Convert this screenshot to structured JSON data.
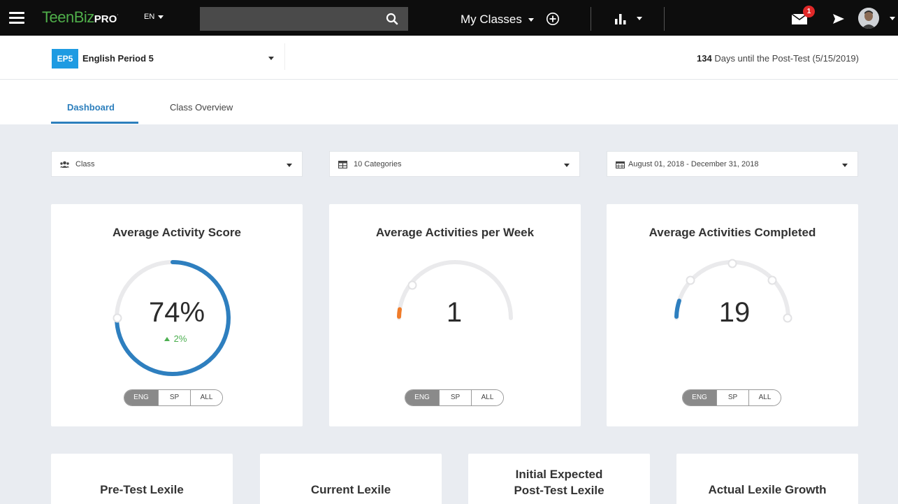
{
  "navbar": {
    "logo_teen": "TeenBiz",
    "logo_pro": "PRO",
    "language": "EN",
    "search_placeholder": "",
    "my_classes_label": "My Classes",
    "mail_badge_count": "1"
  },
  "classbar": {
    "class_code": "EP5",
    "class_name": "English Period 5",
    "days_count": "134",
    "days_text": "Days until the Post-Test (5/15/2019)"
  },
  "tabs": [
    {
      "label": "Dashboard",
      "active": true
    },
    {
      "label": "Class Overview",
      "active": false
    }
  ],
  "filters": {
    "group": "Class",
    "categories": "10 Categories",
    "date_range": "August 01, 2018 - December 31, 2018"
  },
  "cards": [
    {
      "title": "Average Activity Score",
      "value": "74%",
      "delta": "2%",
      "gauge_fraction": 0.74,
      "gauge_color": "#2e7fbf"
    },
    {
      "title": "Average Activities per Week",
      "value": "1",
      "gauge_fraction": 0.05,
      "gauge_color": "#f07c2a"
    },
    {
      "title": "Average Activities Completed",
      "value": "19",
      "gauge_fraction": 0.1,
      "gauge_color": "#2e7fbf"
    }
  ],
  "language_toggle": [
    "ENG",
    "SP",
    "ALL"
  ],
  "bottom_cards": [
    {
      "title": "Pre-Test Lexile"
    },
    {
      "title": "Current Lexile"
    },
    {
      "title_line1": "Initial Expected",
      "title_line2": "Post-Test Lexile"
    },
    {
      "title": "Actual Lexile Growth"
    }
  ]
}
